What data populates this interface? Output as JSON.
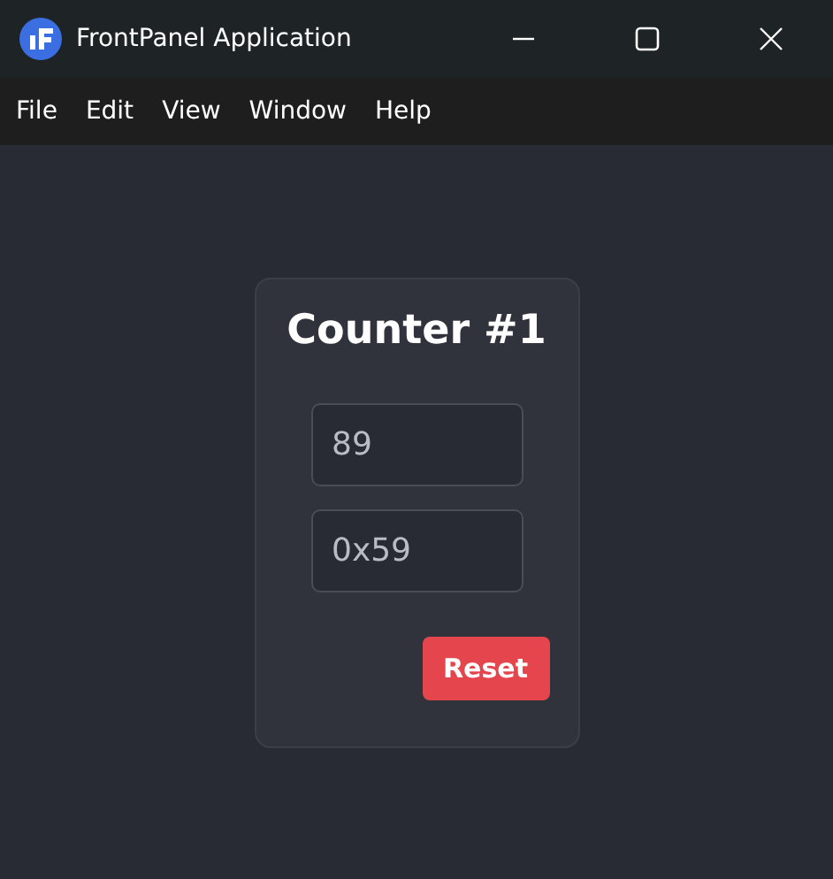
{
  "window": {
    "title": "FrontPanel Application"
  },
  "menu": [
    "File",
    "Edit",
    "View",
    "Window",
    "Help"
  ],
  "card": {
    "title": "Counter #1",
    "fields": [
      {
        "value": "89"
      },
      {
        "value": "0x59"
      }
    ],
    "button": "Reset"
  }
}
